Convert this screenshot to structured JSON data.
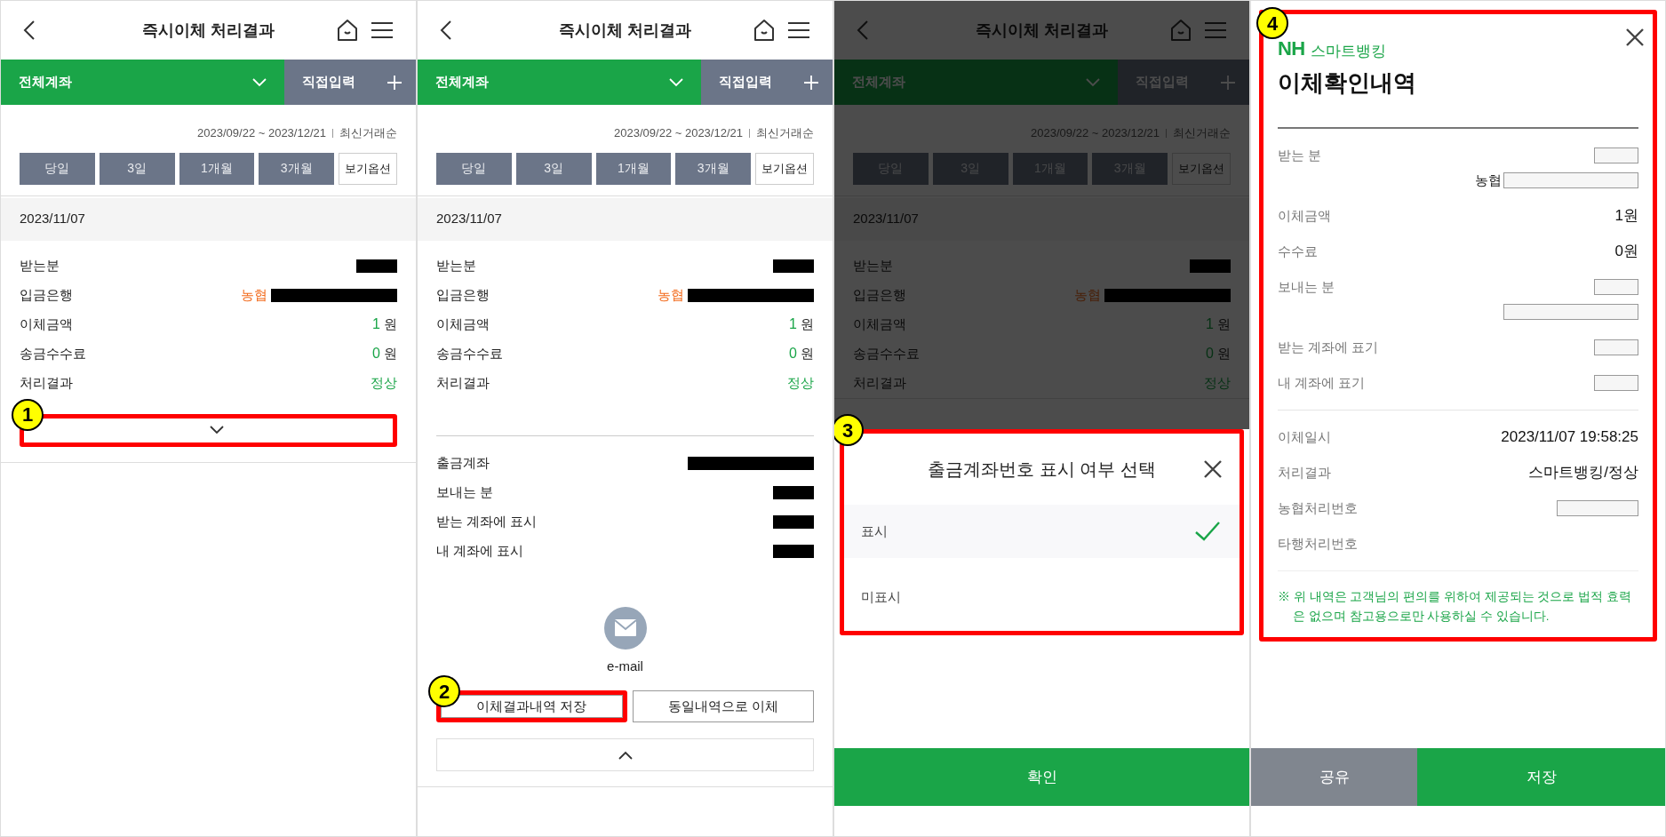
{
  "panels": [
    {
      "kind": "result",
      "dimmed": false,
      "toggle_callout": "1",
      "title": "즉시이체 처리결과",
      "account_selector": "전체계좌",
      "direct_input": "직접입력",
      "period_range": "2023/09/22 ~ 2023/12/21",
      "sort_order": "최신거래순",
      "period_buttons": [
        {
          "label": "당일",
          "kind": "period"
        },
        {
          "label": "3일",
          "kind": "period"
        },
        {
          "label": "1개월",
          "kind": "period"
        },
        {
          "label": "3개월",
          "kind": "period"
        },
        {
          "label": "보기옵션",
          "kind": "options"
        }
      ],
      "date": "2023/11/07",
      "rows": [
        {
          "label": "받는분",
          "kind": "redacted_short"
        },
        {
          "label": "입금은행",
          "kind": "bank",
          "bank": "농협"
        },
        {
          "label": "이체금액",
          "kind": "amount",
          "amount": "1",
          "unit": "원"
        },
        {
          "label": "송금수수료",
          "kind": "amount",
          "amount": "0",
          "unit": "원"
        },
        {
          "label": "처리결과",
          "kind": "status",
          "value": "정상"
        }
      ],
      "detail_expanded": false
    },
    {
      "kind": "result",
      "dimmed": false,
      "title": "즉시이체 처리결과",
      "account_selector": "전체계좌",
      "direct_input": "직접입력",
      "period_range": "2023/09/22 ~ 2023/12/21",
      "sort_order": "최신거래순",
      "period_buttons": [
        {
          "label": "당일",
          "kind": "period"
        },
        {
          "label": "3일",
          "kind": "period"
        },
        {
          "label": "1개월",
          "kind": "period"
        },
        {
          "label": "3개월",
          "kind": "period"
        },
        {
          "label": "보기옵션",
          "kind": "options"
        }
      ],
      "date": "2023/11/07",
      "rows": [
        {
          "label": "받는분",
          "kind": "redacted_short"
        },
        {
          "label": "입금은행",
          "kind": "bank",
          "bank": "농협"
        },
        {
          "label": "이체금액",
          "kind": "amount",
          "amount": "1",
          "unit": "원"
        },
        {
          "label": "송금수수료",
          "kind": "amount",
          "amount": "0",
          "unit": "원"
        },
        {
          "label": "처리결과",
          "kind": "status",
          "value": "정상"
        }
      ],
      "detail_expanded": true,
      "detail": {
        "rows": [
          {
            "label": "출금계좌",
            "kind": "redacted_long"
          },
          {
            "label": "보내는 분",
            "kind": "redacted_short"
          },
          {
            "label": "받는 계좌에 표시",
            "kind": "redacted_short"
          },
          {
            "label": "내 계좌에 표시",
            "kind": "redacted_short"
          }
        ],
        "email": "e-mail",
        "actions": [
          {
            "label": "이체결과내역 저장",
            "callout": "2"
          },
          {
            "label": "동일내역으로 이체"
          }
        ]
      }
    },
    {
      "kind": "result",
      "dimmed": true,
      "title": "즉시이체 처리결과",
      "account_selector": "전체계좌",
      "direct_input": "직접입력",
      "period_range": "2023/09/22 ~ 2023/12/21",
      "sort_order": "최신거래순",
      "period_buttons": [
        {
          "label": "당일",
          "kind": "period"
        },
        {
          "label": "3일",
          "kind": "period"
        },
        {
          "label": "1개월",
          "kind": "period"
        },
        {
          "label": "3개월",
          "kind": "period"
        },
        {
          "label": "보기옵션",
          "kind": "options"
        }
      ],
      "date": "2023/11/07",
      "rows": [
        {
          "label": "받는분",
          "kind": "redacted_short"
        },
        {
          "label": "입금은행",
          "kind": "bank",
          "bank": "농협"
        },
        {
          "label": "이체금액",
          "kind": "amount",
          "amount": "1",
          "unit": "원"
        },
        {
          "label": "송금수수료",
          "kind": "amount",
          "amount": "0",
          "unit": "원"
        },
        {
          "label": "처리결과",
          "kind": "status",
          "value": "정상"
        }
      ],
      "sheet": {
        "callout": "3",
        "title": "출금계좌번호 표시 여부 선택",
        "options": [
          {
            "label": "표시",
            "selected": true
          },
          {
            "label": "미표시",
            "selected": false
          }
        ],
        "confirm": "확인"
      }
    },
    {
      "kind": "receipt",
      "callout": "4",
      "brand": "NH",
      "brand_sub": "스마트뱅킹",
      "title": "이체확인내역",
      "sections": [
        {
          "rows": [
            {
              "label": "받는 분",
              "kind": "blank"
            },
            {
              "kind": "bank_blank",
              "bank": "농협"
            },
            {
              "label": "이체금액",
              "kind": "text",
              "value": "1원"
            },
            {
              "label": "수수료",
              "kind": "text",
              "value": "0원"
            },
            {
              "label": "보내는 분",
              "kind": "blank"
            },
            {
              "kind": "blank_long"
            },
            {
              "label": "받는 계좌에 표기",
              "kind": "blank"
            },
            {
              "label": "내 계좌에 표기",
              "kind": "blank"
            }
          ]
        },
        {
          "rows": [
            {
              "label": "이체일시",
              "kind": "text",
              "value": "2023/11/07 19:58:25"
            },
            {
              "label": "처리결과",
              "kind": "text",
              "value": "스마트뱅킹/정상"
            },
            {
              "label": "농협처리번호",
              "kind": "blank_medium"
            },
            {
              "label": "타행처리번호",
              "kind": "empty"
            }
          ]
        }
      ],
      "note": "※ 위 내역은 고객님의 편의를 위하여 제공되는 것으로 법적 효력은 없으며 참고용으로만 사용하실 수 있습니다.",
      "buttons": [
        {
          "label": "공유",
          "kind": "secondary"
        },
        {
          "label": "저장",
          "kind": "primary"
        }
      ]
    }
  ]
}
